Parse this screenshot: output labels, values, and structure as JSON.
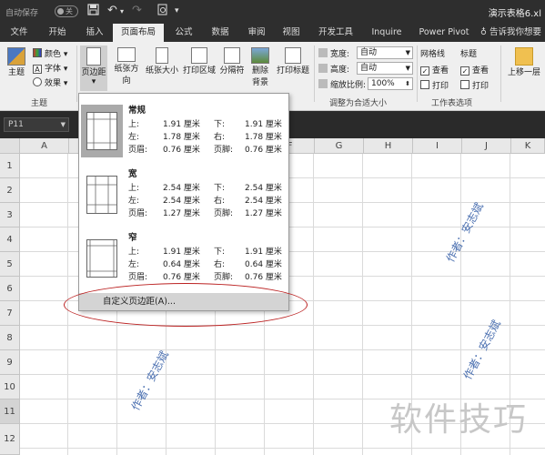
{
  "titlebar": {
    "autosave_label": "自动保存",
    "autosave_state": "关",
    "doc_title": "演示表格6.xl"
  },
  "tabs": [
    "文件",
    "开始",
    "插入",
    "页面布局",
    "公式",
    "数据",
    "审阅",
    "视图",
    "开发工具",
    "Inquire",
    "Power Pivot"
  ],
  "active_tab": "页面布局",
  "tell_me": "告诉我你想要",
  "ribbon": {
    "theme_btn": "主题",
    "colors": "颜色",
    "fonts": "字体",
    "effects": "效果",
    "theme_group": "主题",
    "margins": "页边距",
    "orientation": "纸张方向",
    "size": "纸张大小",
    "print_area": "打印区域",
    "breaks": "分隔符",
    "background": "删除背景",
    "print_titles": "打印标题",
    "width_label": "宽度:",
    "width_value": "自动",
    "height_label": "高度:",
    "height_value": "自动",
    "scale_label": "缩放比例:",
    "scale_value": "100%",
    "scale_group": "调整为合适大小",
    "gridlines": "网格线",
    "headings": "标题",
    "view": "查看",
    "print": "打印",
    "sheet_options_group": "工作表选项",
    "bring_forward": "上移一层"
  },
  "namebox": "P11",
  "columns": [
    "A",
    "B",
    "C",
    "D",
    "E",
    "F",
    "G",
    "H",
    "I",
    "J",
    "K"
  ],
  "rows": [
    "1",
    "2",
    "3",
    "4",
    "5",
    "6",
    "7",
    "8",
    "9",
    "10",
    "11",
    "12"
  ],
  "margins_menu": {
    "presets": [
      {
        "name": "常规",
        "top": "1.91 厘米",
        "bottom": "1.91 厘米",
        "left": "1.78 厘米",
        "right": "1.78 厘米",
        "header": "0.76 厘米",
        "footer": "0.76 厘米"
      },
      {
        "name": "宽",
        "top": "2.54 厘米",
        "bottom": "2.54 厘米",
        "left": "2.54 厘米",
        "right": "2.54 厘米",
        "header": "1.27 厘米",
        "footer": "1.27 厘米"
      },
      {
        "name": "窄",
        "top": "1.91 厘米",
        "bottom": "1.91 厘米",
        "left": "0.64 厘米",
        "right": "0.64 厘米",
        "header": "0.76 厘米",
        "footer": "0.76 厘米"
      }
    ],
    "labels": {
      "top": "上:",
      "bottom": "下:",
      "left": "左:",
      "right": "右:",
      "header": "页眉:",
      "footer": "页脚:"
    },
    "custom": "自定义页边距(A)..."
  },
  "watermarks": {
    "author": "作者：安志斌",
    "logo": "软件技巧"
  },
  "colors": {
    "accent": "#b22222",
    "watermark": "#4a6fb0"
  }
}
